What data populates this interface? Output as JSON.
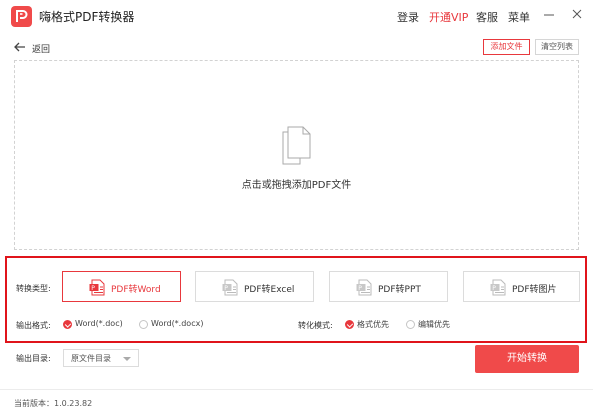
{
  "titlebar": {
    "app_title": "嗨格式PDF转换器",
    "login_label": "登录",
    "vip_label": "开通VIP",
    "support_label": "客服",
    "menu_label": "菜单",
    "vip_color": "#e8383d",
    "brand_color": "#f04a4a"
  },
  "toolbar": {
    "back_label": "返回",
    "add_file_label": "添加文件",
    "clear_list_label": "清空列表"
  },
  "dropzone": {
    "hint": "点击或拖拽添加PDF文件"
  },
  "conversion": {
    "type_label": "转换类型:",
    "types": [
      {
        "label": "PDF转Word",
        "active": true
      },
      {
        "label": "PDF转Excel",
        "active": false
      },
      {
        "label": "PDF转PPT",
        "active": false
      },
      {
        "label": "PDF转图片",
        "active": false
      }
    ],
    "format_label": "输出格式:",
    "formats": [
      {
        "label": "Word(*.doc)",
        "checked": true
      },
      {
        "label": "Word(*.docx)",
        "checked": false
      }
    ],
    "mode_label": "转化模式:",
    "modes": [
      {
        "label": "格式优先",
        "checked": true
      },
      {
        "label": "编辑优先",
        "checked": false
      }
    ]
  },
  "output": {
    "dir_label": "输出目录:",
    "dir_value": "原文件目录"
  },
  "start_button_label": "开始转换",
  "footer": {
    "version_text": "当前版本：1.0.23.82"
  }
}
